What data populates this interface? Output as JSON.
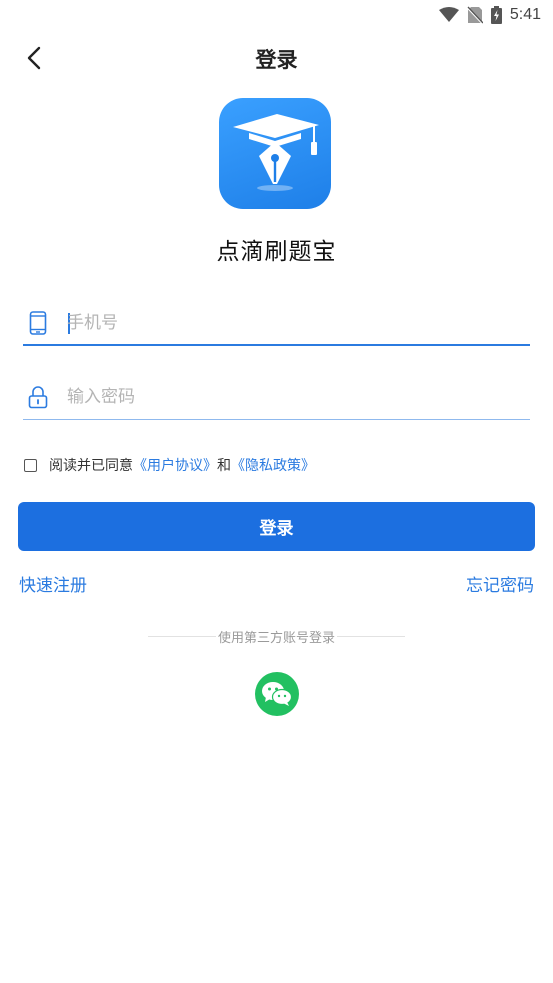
{
  "status_bar": {
    "time": "5:41",
    "icons": [
      "wifi-icon",
      "no-sim-icon",
      "battery-charging-icon"
    ]
  },
  "nav": {
    "title": "登录",
    "back_icon": "chevron-left-icon"
  },
  "app": {
    "name": "点滴刷题宝",
    "logo_icon": "graduation-cap-pen-icon"
  },
  "form": {
    "phone": {
      "placeholder": "手机号",
      "value": "",
      "icon": "mobile-phone-icon"
    },
    "password": {
      "placeholder": "输入密码",
      "value": "",
      "icon": "lock-icon"
    }
  },
  "agreement": {
    "checked": false,
    "prefix": "阅读并已同意",
    "user_agreement": "《用户协议》",
    "and": "和",
    "privacy_policy": "《隐私政策》"
  },
  "login_button": "登录",
  "links": {
    "register": "快速注册",
    "forgot_password": "忘记密码"
  },
  "third_party": {
    "label": "使用第三方账号登录",
    "wechat_icon": "wechat-icon"
  },
  "colors": {
    "accent": "#1c6fe0",
    "link": "#2b7be0",
    "wechat": "#22c061"
  }
}
